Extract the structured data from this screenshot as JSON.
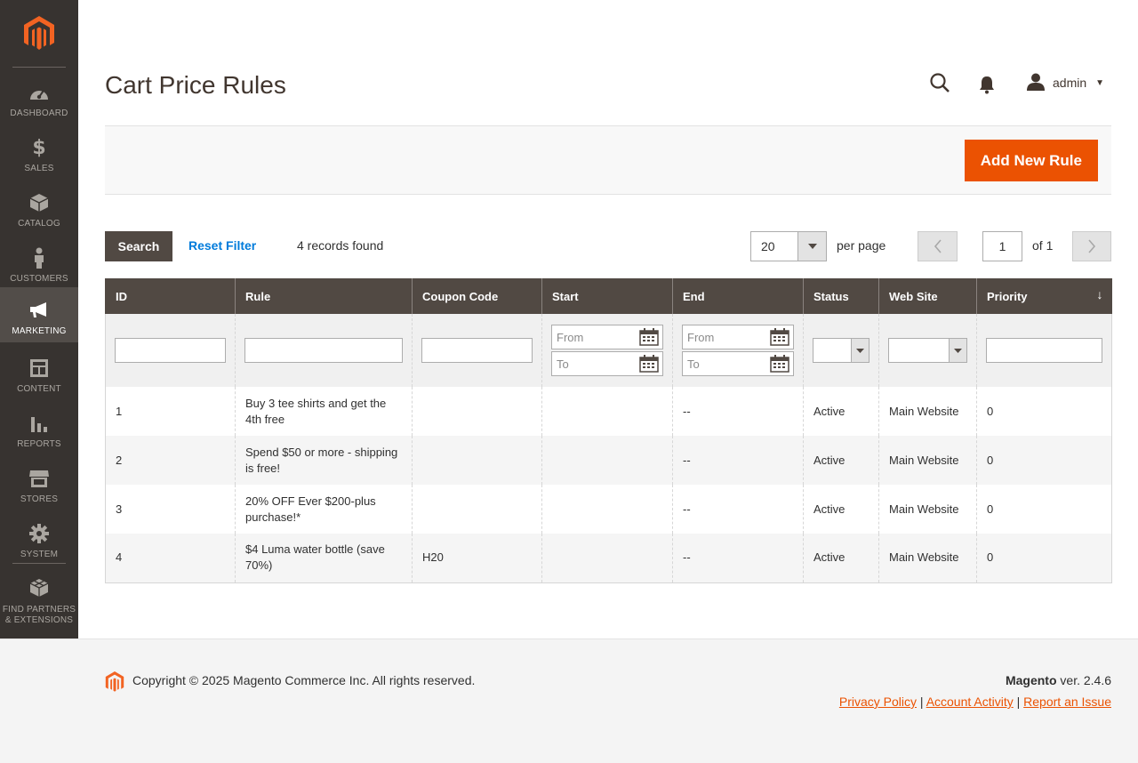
{
  "sidebar": {
    "items": [
      {
        "label": "DASHBOARD",
        "icon": "dashboard-icon"
      },
      {
        "label": "SALES",
        "icon": "dollar-icon"
      },
      {
        "label": "CATALOG",
        "icon": "box-icon"
      },
      {
        "label": "CUSTOMERS",
        "icon": "person-icon"
      },
      {
        "label": "MARKETING",
        "icon": "megaphone-icon",
        "active": true
      },
      {
        "label": "CONTENT",
        "icon": "layout-icon"
      },
      {
        "label": "REPORTS",
        "icon": "bar-chart-icon"
      },
      {
        "label": "STORES",
        "icon": "store-icon"
      },
      {
        "label": "SYSTEM",
        "icon": "gear-icon"
      },
      {
        "label_line1": "FIND PARTNERS",
        "label_line2": "& EXTENSIONS",
        "icon": "cubes-icon"
      }
    ]
  },
  "header": {
    "title": "Cart Price Rules",
    "user": "admin"
  },
  "actions": {
    "add_new": "Add New Rule"
  },
  "controls": {
    "search": "Search",
    "reset": "Reset Filter",
    "records": "4 records found",
    "per_page_value": "20",
    "per_page_label": "per page",
    "page_value": "1",
    "page_of": "of 1"
  },
  "grid": {
    "columns": [
      "ID",
      "Rule",
      "Coupon Code",
      "Start",
      "End",
      "Status",
      "Web Site",
      "Priority"
    ],
    "filters": {
      "from": "From",
      "to": "To"
    },
    "rows": [
      {
        "id": "1",
        "rule": "Buy 3 tee shirts and get the 4th free",
        "coupon": "",
        "start": "",
        "end": "--",
        "status": "Active",
        "website": "Main Website",
        "priority": "0"
      },
      {
        "id": "2",
        "rule": "Spend $50 or more - shipping is free!",
        "coupon": "",
        "start": "",
        "end": "--",
        "status": "Active",
        "website": "Main Website",
        "priority": "0"
      },
      {
        "id": "3",
        "rule": "20% OFF Ever $200-plus purchase!*",
        "coupon": "",
        "start": "",
        "end": "--",
        "status": "Active",
        "website": "Main Website",
        "priority": "0"
      },
      {
        "id": "4",
        "rule": "$4 Luma water bottle (save 70%)",
        "coupon": "H20",
        "start": "",
        "end": "--",
        "status": "Active",
        "website": "Main Website",
        "priority": "0"
      }
    ]
  },
  "footer": {
    "copyright": "Copyright © 2025 Magento Commerce Inc. All rights reserved.",
    "brand": "Magento",
    "version": " ver. 2.4.6",
    "links": [
      "Privacy Policy",
      "Account Activity",
      "Report an Issue"
    ],
    "separator": "|"
  },
  "colors": {
    "sidebar": "#373330",
    "accent": "#eb5202",
    "header_row": "#514943",
    "link": "#007bdb"
  }
}
